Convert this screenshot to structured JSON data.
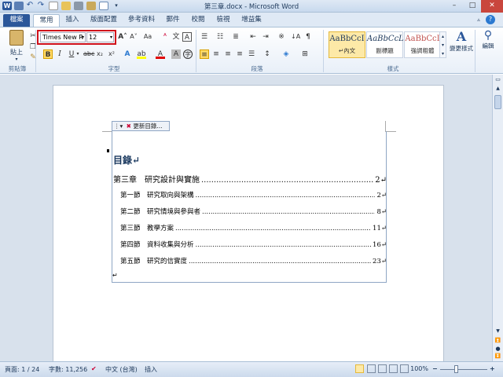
{
  "window": {
    "title": "第三章.docx - Microsoft Word",
    "word_icon": "W",
    "minimize": "–",
    "maximize": "□",
    "close": "✕"
  },
  "tabs": [
    "檔案",
    "常用",
    "插入",
    "版面配置",
    "參考資料",
    "郵件",
    "校閱",
    "檢視",
    "增益集"
  ],
  "ribbon": {
    "paste_label": "貼上",
    "clipboard_label": "剪貼簿",
    "font_label": "字型",
    "paragraph_label": "段落",
    "styles_label": "樣式",
    "font_name": "Times New R",
    "font_size": "12",
    "styles": [
      {
        "sample": "AaBbCcI",
        "name": "↵內文",
        "color": "#000000"
      },
      {
        "sample": "AaBbCcL",
        "name": "副標題",
        "color": "#000000"
      },
      {
        "sample": "AaBbCcI",
        "name": "強調粗體",
        "color": "#c0504d"
      }
    ],
    "change_styles": "變更樣式",
    "editing": "編輯"
  },
  "toc": {
    "update_button": "更新目錄...",
    "heading": "目錄↵",
    "entries": [
      {
        "label": "第三章　研究設計與實施",
        "page": "2↵"
      },
      {
        "label": "第一節　研究取向與架構",
        "page": "2↵"
      },
      {
        "label": "第二節　研究情境與參與者",
        "page": "8↵"
      },
      {
        "label": "第三節　教學方案",
        "page": "11↵"
      },
      {
        "label": "第四節　資料收集與分析",
        "page": "16↵"
      },
      {
        "label": "第五節　研究的信實度",
        "page": "23↵"
      }
    ],
    "end_mark": "↵"
  },
  "status": {
    "page": "頁面: 1 / 24",
    "words": "字數: 11,256",
    "language": "中文 (台灣)",
    "mode": "插入",
    "zoom": "100%",
    "zoom_minus": "−",
    "zoom_plus": "+"
  }
}
